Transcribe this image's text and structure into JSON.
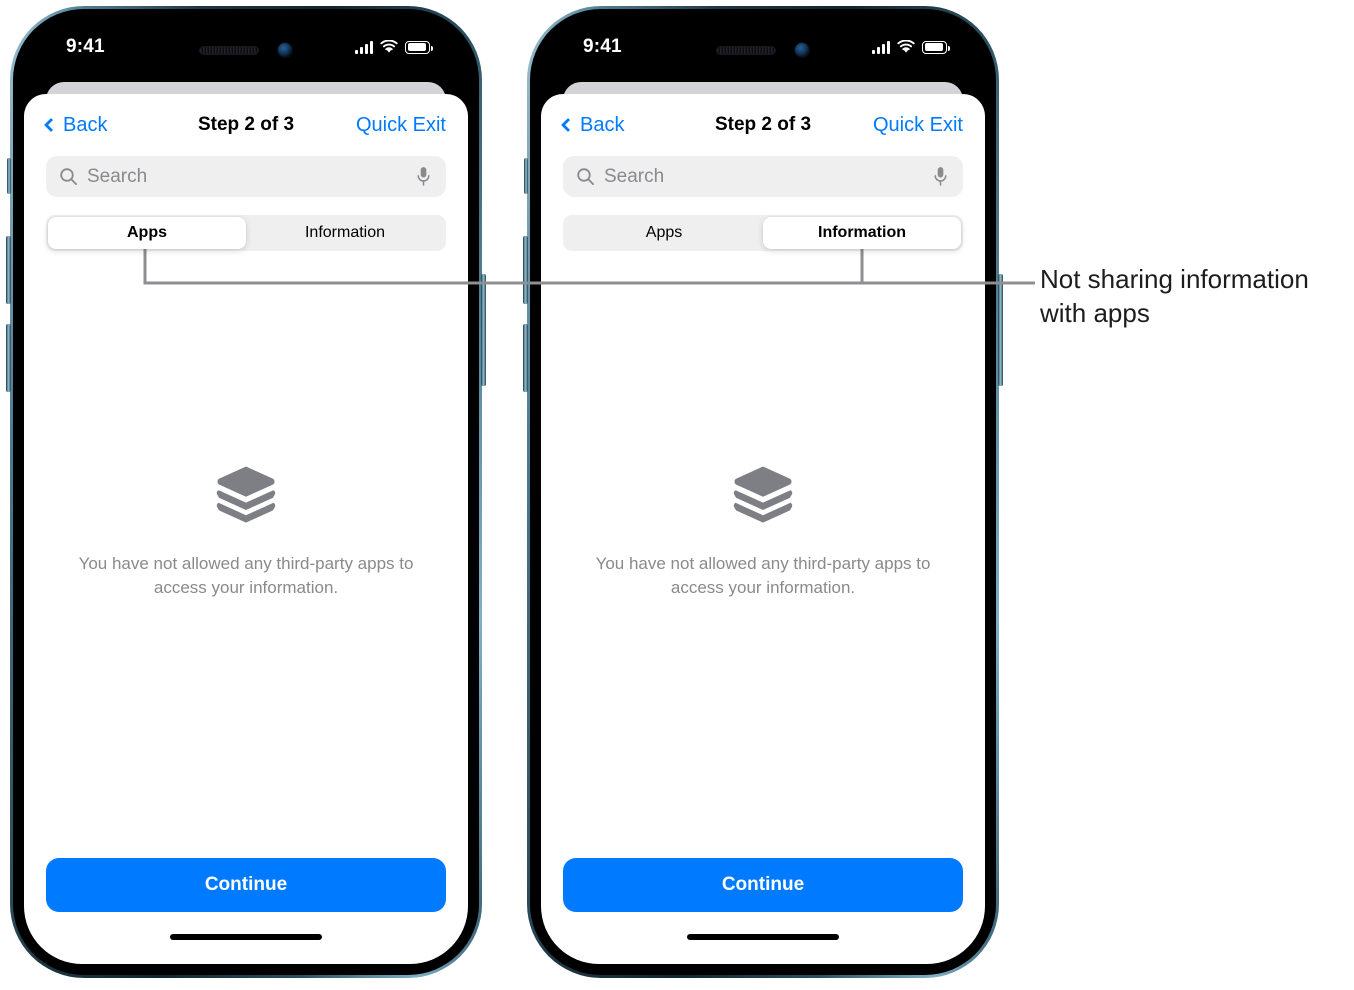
{
  "phones": [
    {
      "id": "left",
      "status_bar": {
        "time": "9:41",
        "signal_icon": "cellular-bars-icon",
        "wifi_icon": "wifi-icon",
        "battery_icon": "battery-icon"
      },
      "nav": {
        "back_label": "Back",
        "title": "Step 2 of 3",
        "quick_exit_label": "Quick Exit"
      },
      "search": {
        "placeholder": "Search",
        "search_icon": "search-icon",
        "mic_icon": "microphone-icon"
      },
      "segmented": {
        "options": [
          "Apps",
          "Information"
        ],
        "selected": "Apps",
        "selected_index": 0
      },
      "empty_state": {
        "icon": "stacked-layers-icon",
        "message": "You have not allowed any third-party apps to access your information."
      },
      "cta": {
        "label": "Continue"
      }
    },
    {
      "id": "right",
      "status_bar": {
        "time": "9:41",
        "signal_icon": "cellular-bars-icon",
        "wifi_icon": "wifi-icon",
        "battery_icon": "battery-icon"
      },
      "nav": {
        "back_label": "Back",
        "title": "Step 2 of 3",
        "quick_exit_label": "Quick Exit"
      },
      "search": {
        "placeholder": "Search",
        "search_icon": "search-icon",
        "mic_icon": "microphone-icon"
      },
      "segmented": {
        "options": [
          "Apps",
          "Information"
        ],
        "selected": "Information",
        "selected_index": 1
      },
      "empty_state": {
        "icon": "stacked-layers-icon",
        "message": "You have not allowed any third-party apps to access your information."
      },
      "cta": {
        "label": "Continue"
      }
    }
  ],
  "callout": {
    "text_line_1": "Not sharing information",
    "text_line_2": "with apps",
    "leader_color": "#8e8e93"
  },
  "colors": {
    "accent_blue": "#007AFF",
    "field_gray": "#EFEFF0",
    "placeholder_gray": "#8A8A8E",
    "sheet_back_gray": "#D3D3D8",
    "empty_icon_gray": "#7E7E85",
    "text_black": "#000000"
  }
}
